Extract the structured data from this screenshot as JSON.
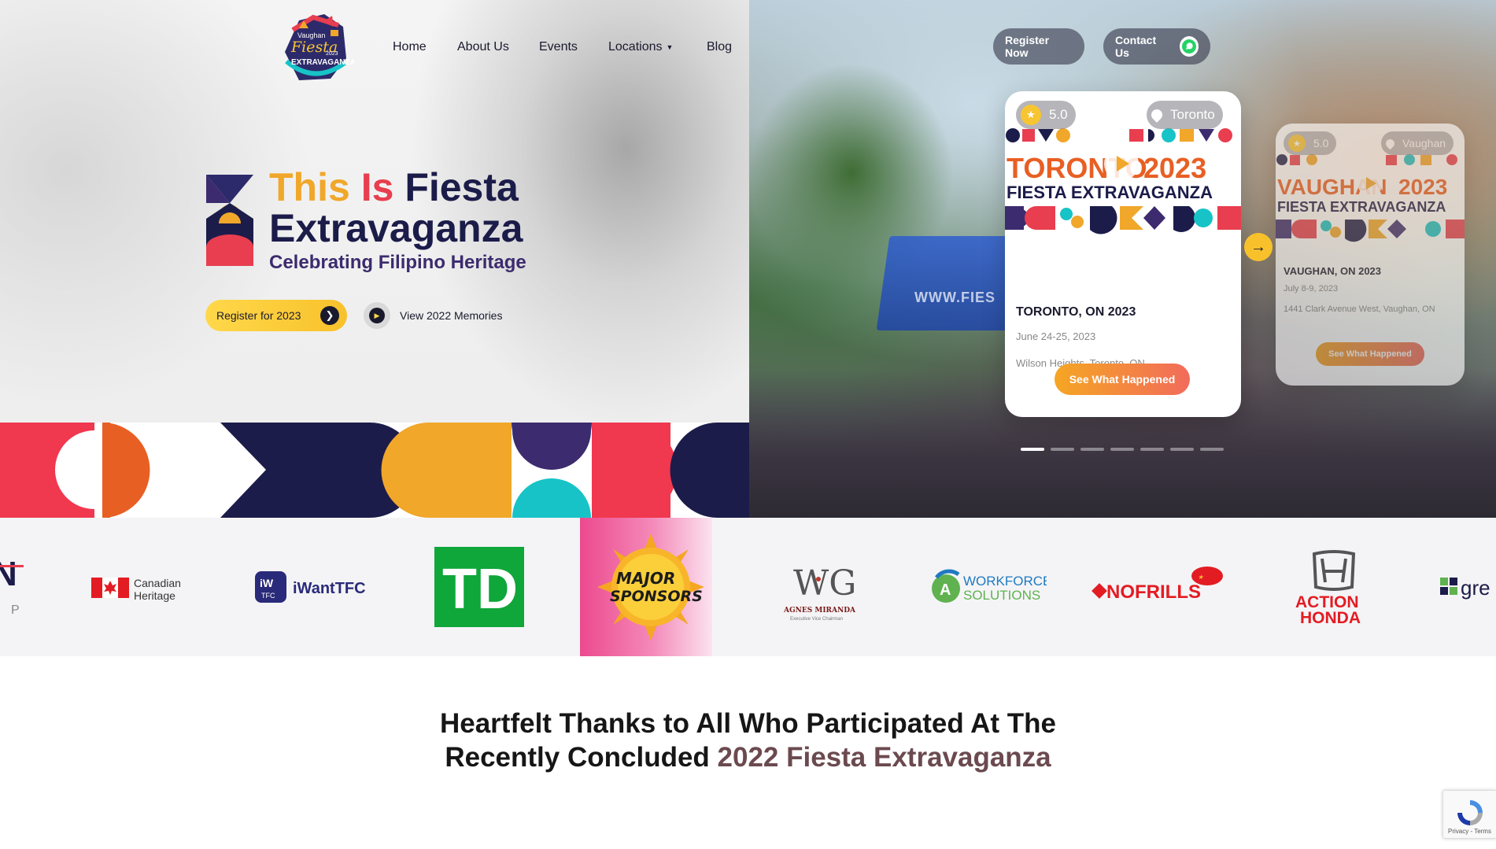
{
  "nav": {
    "items": [
      {
        "label": "Home"
      },
      {
        "label": "About Us"
      },
      {
        "label": "Events"
      },
      {
        "label": "Locations",
        "has_dropdown": true
      },
      {
        "label": "Blog"
      }
    ],
    "register_label": "Register Now",
    "contact_label": "Contact Us"
  },
  "logo": {
    "text_top": "Vaughan",
    "text_main": "Fiesta",
    "text_bottom": "EXTRAVAGANZA",
    "year": "2023"
  },
  "hero": {
    "title_this": "This",
    "title_is": "Is",
    "title_fiesta": "Fiesta",
    "title_line2": "Extravaganza",
    "subtitle": "Celebrating Filipino Heritage",
    "cta_register": "Register for 2023",
    "cta_memories": "View 2022 Memories"
  },
  "events": [
    {
      "rating": "5.0",
      "city_badge": "Toronto",
      "banner_city": "TORONTO",
      "banner_year": "2023",
      "banner_sub": "FIESTA EXTRAVAGANZA",
      "title": "TORONTO, ON 2023",
      "date": "June 24-25, 2023",
      "venue": "Wilson Heights, Toronto, ON",
      "button": "See What Happened"
    },
    {
      "rating": "5.0",
      "city_badge": "Vaughan",
      "banner_city": "VAUGHAN",
      "banner_year": "2023",
      "banner_sub": "FIESTA EXTRAVAGANZA",
      "title": "VAUGHAN, ON 2023",
      "date": "July 8-9, 2023",
      "venue": "1441 Clark Avenue West, Vaughan, ON",
      "button": "See What Happened"
    }
  ],
  "slider": {
    "dot_count": 7,
    "active_index": 0
  },
  "tent_text": "WWW.FIES",
  "sponsors": {
    "partial_left": "N",
    "partial_left_sub": "P",
    "canadian_heritage": [
      "Canadian",
      "Heritage"
    ],
    "iwanttfc": "iWantTFC",
    "iwanttfc_badge_top": "iW",
    "iwanttfc_badge_bottom": "TFC",
    "td": "TD",
    "major": [
      "MAJOR",
      "SPONSORS"
    ],
    "agnes": {
      "monogram": "WG",
      "name": "AGNES MIRANDA",
      "role": "Executive Vice Chairman"
    },
    "workforce": [
      "WORKFORCE",
      "SOLUTIONS"
    ],
    "workforce_badge": "A",
    "nofrills": "NOFRILLS",
    "honda": [
      "ACTION",
      "HONDA"
    ],
    "partial_right": "gre"
  },
  "thanks": {
    "line1": "Heartfelt Thanks to All Who Participated At The",
    "line2_plain": "Recently Concluded ",
    "line2_highlight": "2022 Fiesta Extravaganza"
  },
  "recaptcha": {
    "text": "Privacy - Terms"
  },
  "colors": {
    "navy": "#1c1c4a",
    "yellow": "#f0a72a",
    "red": "#e83e4f",
    "purple": "#3c2b6e",
    "teal": "#17c3c7",
    "orange": "#e85f24",
    "pill_gray": "#5b5e6e"
  },
  "icons": [
    "star-icon",
    "location-pin-icon",
    "play-icon",
    "arrow-right-icon",
    "chevron-down-icon",
    "whatsapp-icon"
  ]
}
